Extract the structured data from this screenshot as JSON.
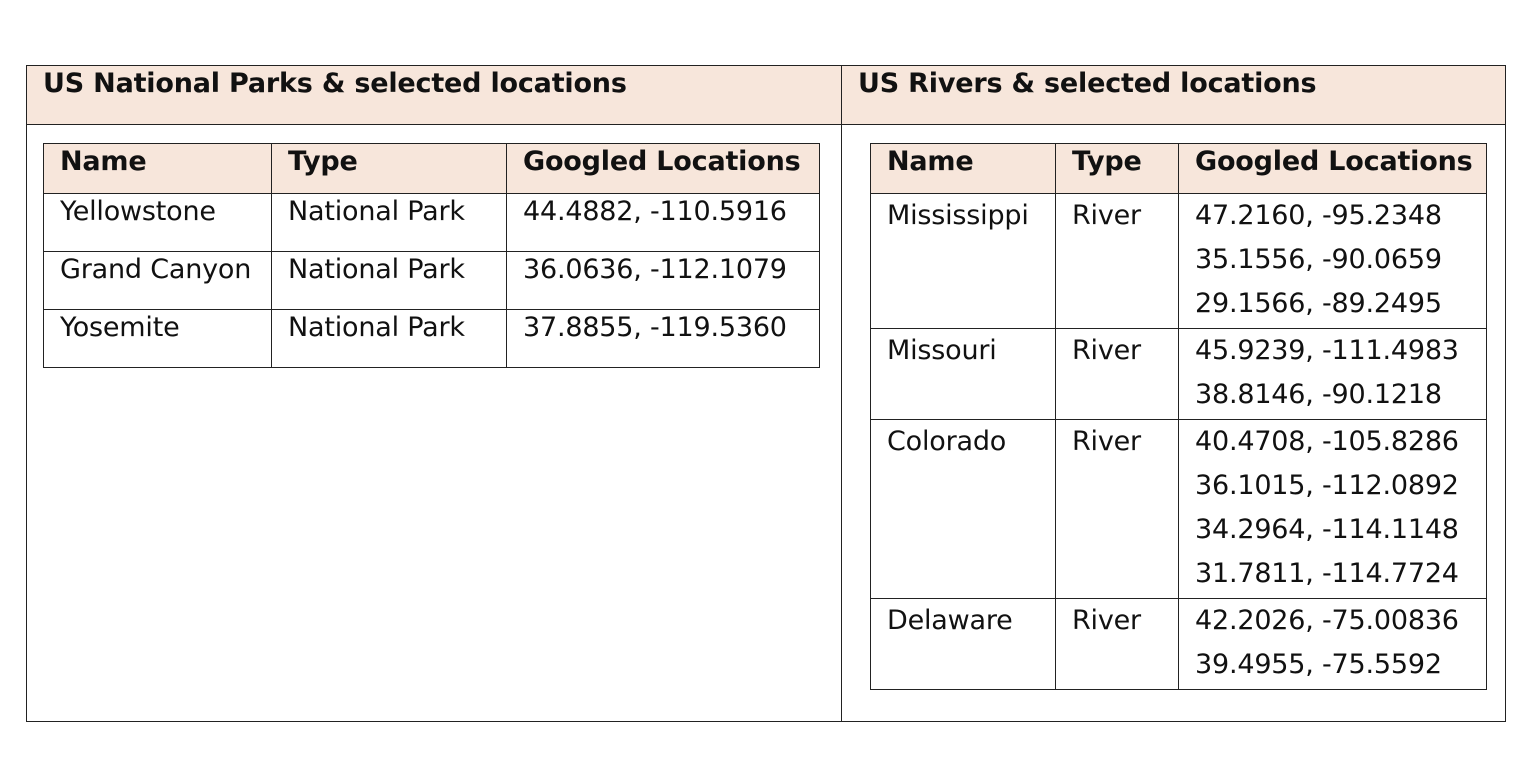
{
  "parks": {
    "title": "US National Parks & selected locations",
    "headers": [
      "Name",
      "Type",
      "Googled Locations"
    ],
    "rows": [
      {
        "name": "Yellowstone",
        "type": "National Park",
        "locations": [
          "44.4882, -110.5916"
        ]
      },
      {
        "name": "Grand Canyon",
        "type": "National Park",
        "locations": [
          "36.0636, -112.1079"
        ]
      },
      {
        "name": "Yosemite",
        "type": "National Park",
        "locations": [
          "37.8855, -119.5360"
        ]
      }
    ]
  },
  "rivers": {
    "title": "US Rivers & selected locations",
    "headers": [
      "Name",
      "Type",
      "Googled Locations"
    ],
    "rows": [
      {
        "name": "Mississippi",
        "type": "River",
        "locations": [
          "47.2160, -95.2348",
          "35.1556, -90.0659",
          "29.1566, -89.2495"
        ]
      },
      {
        "name": "Missouri",
        "type": "River",
        "locations": [
          "45.9239, -111.4983",
          "38.8146, -90.1218"
        ]
      },
      {
        "name": "Colorado",
        "type": "River",
        "locations": [
          "40.4708, -105.8286",
          "36.1015, -112.0892",
          "34.2964, -114.1148",
          "31.7811, -114.7724"
        ]
      },
      {
        "name": "Delaware",
        "type": "River",
        "locations": [
          "42.2026, -75.00836",
          "39.4955, -75.5592"
        ]
      }
    ]
  }
}
